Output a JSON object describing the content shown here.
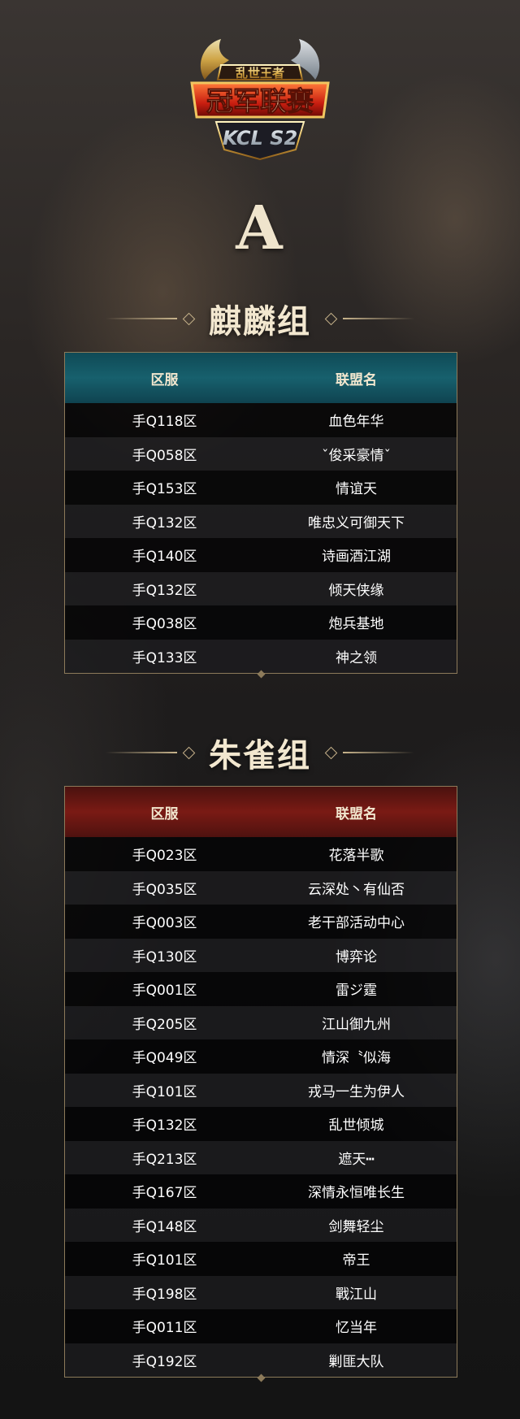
{
  "logo": {
    "top_text": "乱世王者",
    "main_text": "冠军联赛",
    "sub_text": "KCL S2"
  },
  "letter": "A",
  "groups": [
    {
      "title": "麒麟组",
      "header": {
        "col1": "区服",
        "col2": "联盟名"
      },
      "header_color": "#17606d",
      "rows": [
        {
          "server": "手Q118区",
          "alliance": "血色年华"
        },
        {
          "server": "手Q058区",
          "alliance": "ˇ俊采豪情ˇ"
        },
        {
          "server": "手Q153区",
          "alliance": "情谊天"
        },
        {
          "server": "手Q132区",
          "alliance": "唯忠义可御天下"
        },
        {
          "server": "手Q140区",
          "alliance": "诗画酒江湖"
        },
        {
          "server": "手Q132区",
          "alliance": "倾天侠缘"
        },
        {
          "server": "手Q038区",
          "alliance": "炮兵基地"
        },
        {
          "server": "手Q133区",
          "alliance": "神之领"
        }
      ]
    },
    {
      "title": "朱雀组",
      "header": {
        "col1": "区服",
        "col2": "联盟名"
      },
      "header_color": "#7a1a14",
      "rows": [
        {
          "server": "手Q023区",
          "alliance": "花落半歌"
        },
        {
          "server": "手Q035区",
          "alliance": "云深处丶有仙否"
        },
        {
          "server": "手Q003区",
          "alliance": "老干部活动中心"
        },
        {
          "server": "手Q130区",
          "alliance": "博弈论"
        },
        {
          "server": "手Q001区",
          "alliance": "雷ジ霆"
        },
        {
          "server": "手Q205区",
          "alliance": "江山御九州"
        },
        {
          "server": "手Q049区",
          "alliance": "情深〝似海"
        },
        {
          "server": "手Q101区",
          "alliance": "戎马一生为伊人"
        },
        {
          "server": "手Q132区",
          "alliance": "乱世倾城"
        },
        {
          "server": "手Q213区",
          "alliance": "遮天┅"
        },
        {
          "server": "手Q167区",
          "alliance": "深情永恒唯长生"
        },
        {
          "server": "手Q148区",
          "alliance": "剑舞轻尘"
        },
        {
          "server": "手Q101区",
          "alliance": "帝王"
        },
        {
          "server": "手Q198区",
          "alliance": "戰江山"
        },
        {
          "server": "手Q011区",
          "alliance": "忆当年"
        },
        {
          "server": "手Q192区",
          "alliance": "剿匪大队"
        }
      ]
    }
  ]
}
